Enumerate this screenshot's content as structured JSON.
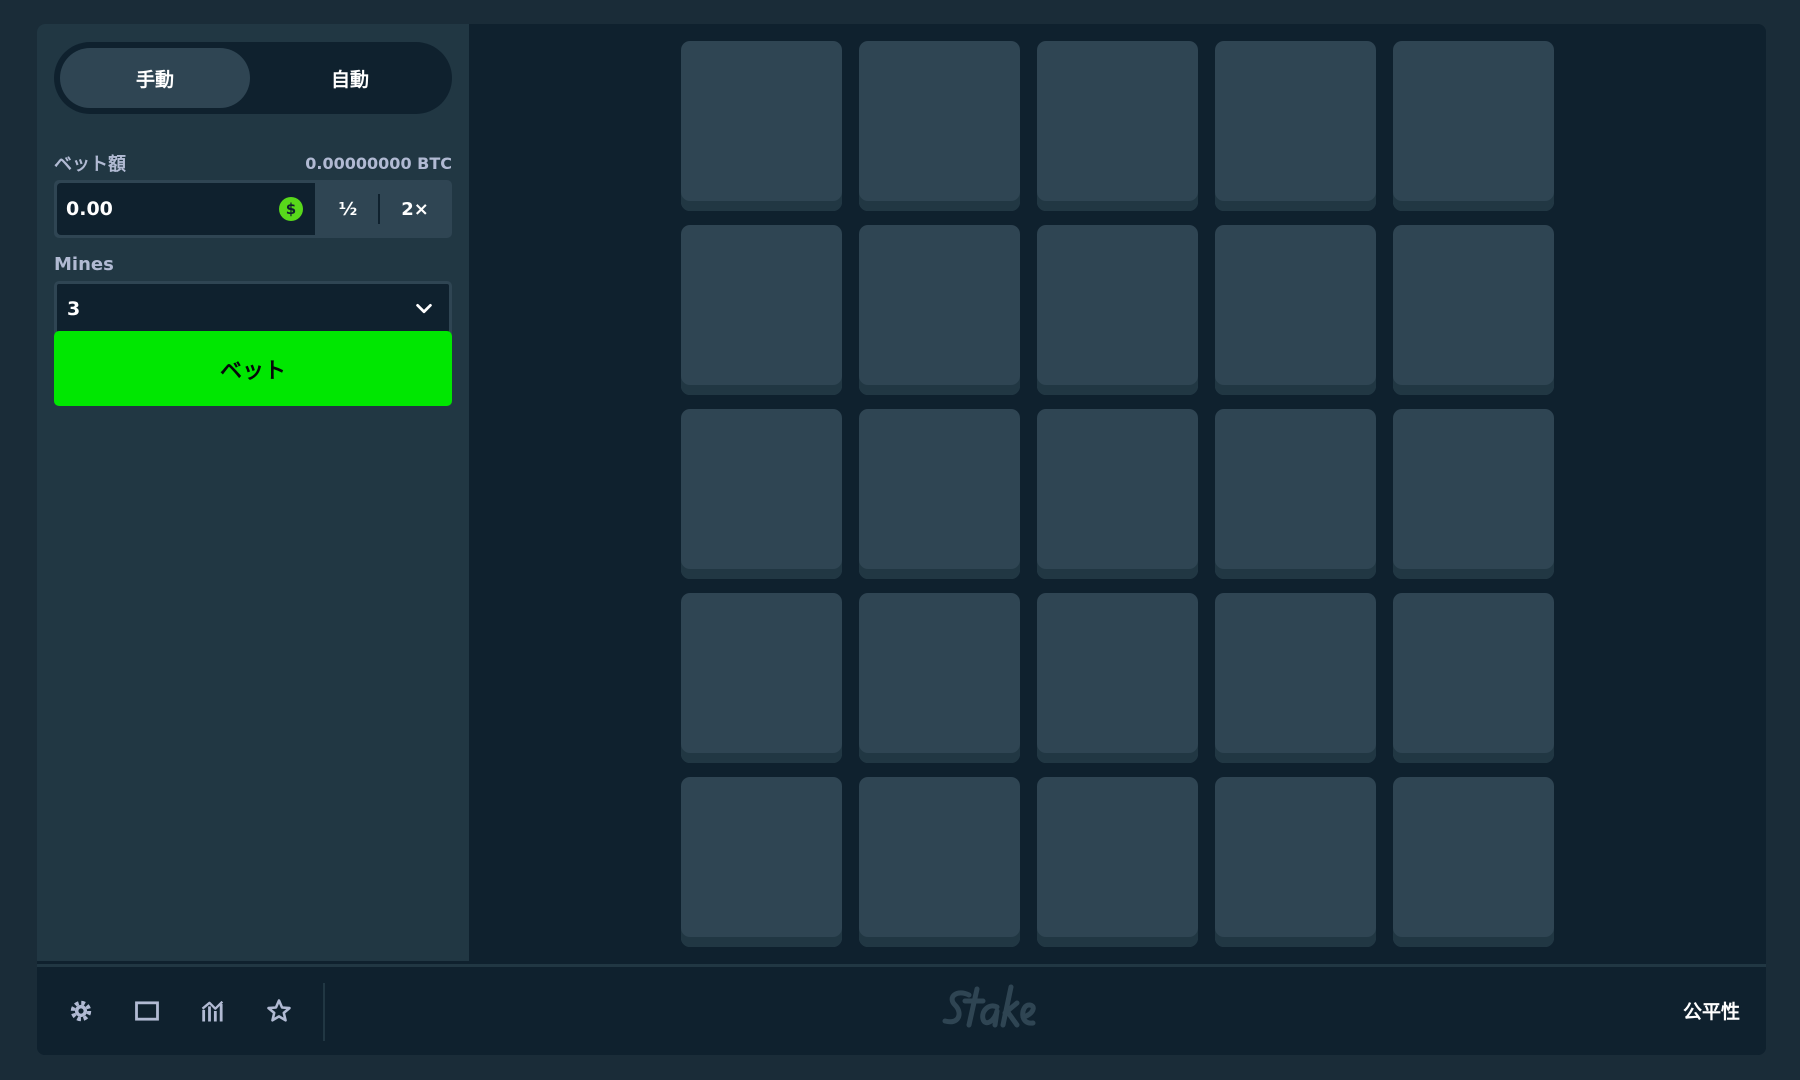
{
  "sidebar": {
    "mode_tabs": [
      {
        "label": "手動",
        "active": true
      },
      {
        "label": "自動",
        "active": false
      }
    ],
    "bet_amount": {
      "label": "ベット額",
      "balance": "0.00000000 BTC",
      "value": "0.00",
      "currency_icon": "$",
      "half_label": "½",
      "double_label": "2×"
    },
    "mines": {
      "label": "Mines",
      "selected": "3"
    },
    "bet_button_label": "ベット"
  },
  "board": {
    "rows": 5,
    "cols": 5
  },
  "footer": {
    "icons": [
      "gear-icon",
      "theatre-mode-icon",
      "stats-icon",
      "star-icon"
    ],
    "fairness_label": "公平性"
  },
  "colors": {
    "background": "#1a2c38",
    "panel": "#213743",
    "board_bg": "#0f212e",
    "tile": "#2f4553",
    "bet_button": "#00e701",
    "coin": "#58d91b"
  }
}
